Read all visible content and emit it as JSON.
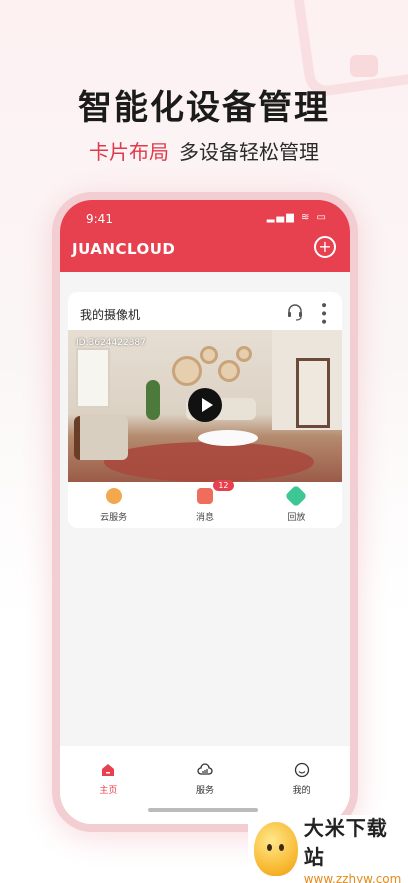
{
  "promo": {
    "headline": "智能化设备管理",
    "sub_accent": "卡片布局",
    "sub_rest": "多设备轻松管理"
  },
  "status_bar": {
    "time": "9:41",
    "icons": "▂▄▆ ≋ ▭"
  },
  "app": {
    "brand": "JUANCLOUD",
    "add_icon": "plus-circle-icon",
    "accent_color": "#e7414f"
  },
  "camera_card": {
    "title": "我的摄像机",
    "video_id": "ID:3624422387",
    "actions": [
      {
        "label": "云服务",
        "icon": "cloud-upload-icon"
      },
      {
        "label": "消息",
        "icon": "message-icon",
        "badge": "12"
      },
      {
        "label": "回放",
        "icon": "playback-icon"
      }
    ]
  },
  "tabs": [
    {
      "label": "主页",
      "icon": "home-icon",
      "active": true
    },
    {
      "label": "服务",
      "icon": "cloud-service-icon",
      "active": false
    },
    {
      "label": "我的",
      "icon": "profile-icon",
      "active": false
    }
  ],
  "watermark": {
    "name": "大米下载站",
    "url": "www.zzhyw.com"
  }
}
